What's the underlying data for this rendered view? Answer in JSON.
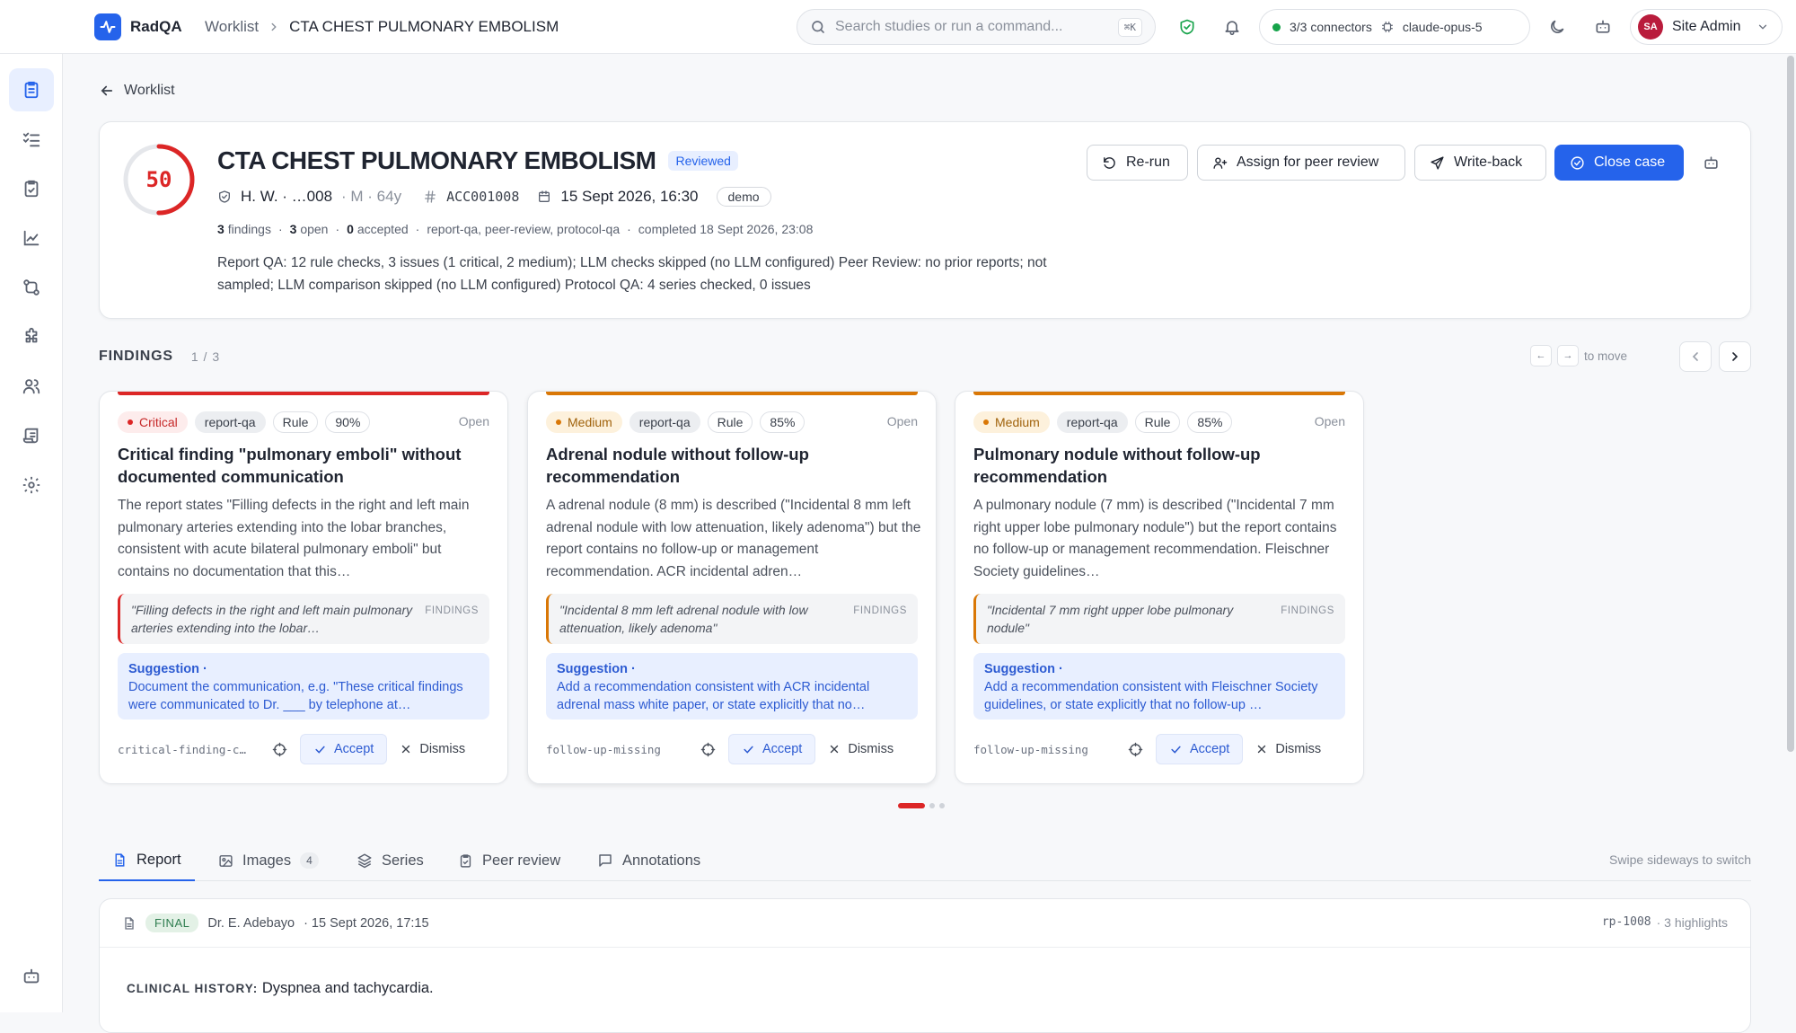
{
  "app": {
    "brand": "RadQA"
  },
  "breadcrumb": {
    "parent": "Worklist",
    "current": "CTA CHEST PULMONARY EMBOLISM"
  },
  "search": {
    "placeholder": "Search studies or run a command...",
    "shortcut": "⌘K"
  },
  "connectors": {
    "status": "3/3 connectors",
    "model": "claude-opus-5",
    "status_color": "#16a34a"
  },
  "user": {
    "initials": "SA",
    "name": "Site Admin",
    "avatar_color": "#b91c3c"
  },
  "sidebar": {
    "items": [
      {
        "icon": "clipboard-list-icon",
        "active": true
      },
      {
        "icon": "list-checks-icon"
      },
      {
        "icon": "clipboard-check-icon"
      },
      {
        "icon": "line-chart-icon"
      },
      {
        "icon": "compare-icon"
      },
      {
        "icon": "puzzle-icon"
      },
      {
        "icon": "users-icon"
      },
      {
        "icon": "scroll-icon"
      },
      {
        "icon": "gear-icon"
      },
      {
        "icon": "bot-icon"
      }
    ]
  },
  "back": {
    "label": "Worklist"
  },
  "study": {
    "score": "50",
    "score_fraction": 0.5,
    "score_color": "#dc2626",
    "title": "CTA CHEST PULMONARY EMBOLISM",
    "status_badge": "Reviewed",
    "patient": "H. W. · …008",
    "demographics": "· M · 64y",
    "accession": "ACC001008",
    "date": "15 Sept 2026, 16:30",
    "tag": "demo",
    "stats": {
      "findings_num": "3",
      "findings_label": "findings",
      "open_num": "3",
      "open_label": "open",
      "accepted_num": "0",
      "accepted_label": "accepted",
      "checks": "report-qa, peer-review, protocol-qa",
      "completed": "completed 18 Sept 2026, 23:08"
    },
    "summary": "Report QA: 12 rule checks, 3 issues (1 critical, 2 medium); LLM checks skipped (no LLM configured) Peer Review: no prior reports; not sampled; LLM comparison skipped (no LLM configured) Protocol QA: 4 series checked, 0 issues"
  },
  "actions": {
    "rerun": "Re-run",
    "assign": "Assign for peer review",
    "writeback": "Write-back",
    "close": "Close case"
  },
  "findings": {
    "heading": "FINDINGS",
    "count": "1 / 3",
    "move_hint": "to move",
    "key_prev": "←",
    "key_next": "→",
    "accent_colors": {
      "critical": "#dc2626",
      "medium": "#d97706"
    },
    "items": [
      {
        "severity": "Critical",
        "source": "report-qa",
        "type": "Rule",
        "confidence": "90%",
        "status": "Open",
        "title": "Critical finding \"pulmonary emboli\" without documented communication",
        "body": "The report states \"Filling defects in the right and left main pulmonary arteries extending into the lobar branches, consistent with acute bilateral pulmonary emboli\" but contains no documentation that this…",
        "quote": "\"Filling defects in the right and left main pulmonary arteries extending into the lobar…",
        "quote_section": "FINDINGS",
        "suggestion_label": "Suggestion ·",
        "suggestion": "Document the communication, e.g. \"These critical findings were communicated to Dr. ___ by telephone at…",
        "rule_id": "critical-finding-c…",
        "accept": "Accept",
        "dismiss": "Dismiss"
      },
      {
        "severity": "Medium",
        "source": "report-qa",
        "type": "Rule",
        "confidence": "85%",
        "status": "Open",
        "title": "Adrenal nodule without follow-up recommendation",
        "body": "A adrenal nodule (8 mm) is described (\"Incidental 8 mm left adrenal nodule with low attenuation, likely adenoma\") but the report contains no follow-up or management recommendation. ACR incidental adren…",
        "quote": "\"Incidental 8 mm left adrenal nodule with low attenuation, likely adenoma\"",
        "quote_section": "FINDINGS",
        "suggestion_label": "Suggestion ·",
        "suggestion": "Add a recommendation consistent with ACR incidental adrenal mass white paper, or state explicitly that no…",
        "rule_id": "follow-up-missing",
        "accept": "Accept",
        "dismiss": "Dismiss"
      },
      {
        "severity": "Medium",
        "source": "report-qa",
        "type": "Rule",
        "confidence": "85%",
        "status": "Open",
        "title": "Pulmonary nodule without follow-up recommendation",
        "body": "A pulmonary nodule (7 mm) is described (\"Incidental 7 mm right upper lobe pulmonary nodule\") but the report contains no follow-up or management recommendation. Fleischner Society guidelines…",
        "quote": "\"Incidental 7 mm right upper lobe pulmonary nodule\"",
        "quote_section": "FINDINGS",
        "suggestion_label": "Suggestion ·",
        "suggestion": "Add a recommendation consistent with Fleischner Society guidelines, or state explicitly that no follow-up …",
        "rule_id": "follow-up-missing",
        "accept": "Accept",
        "dismiss": "Dismiss"
      }
    ]
  },
  "tabs": {
    "items": [
      {
        "label": "Report",
        "icon": "file-text-icon",
        "active": true
      },
      {
        "label": "Images",
        "icon": "image-icon",
        "count": "4"
      },
      {
        "label": "Series",
        "icon": "layers-icon"
      },
      {
        "label": "Peer review",
        "icon": "clipboard-check-icon"
      },
      {
        "label": "Annotations",
        "icon": "message-square-icon"
      }
    ],
    "hint": "Swipe sideways to switch"
  },
  "report": {
    "status": "FINAL",
    "author": "Dr. E. Adebayo",
    "date": "· 15 Sept 2026, 17:15",
    "id": "rp-1008",
    "highlights": "· 3 highlights",
    "history_label": "CLINICAL HISTORY:",
    "history": "Dyspnea and tachycardia."
  }
}
